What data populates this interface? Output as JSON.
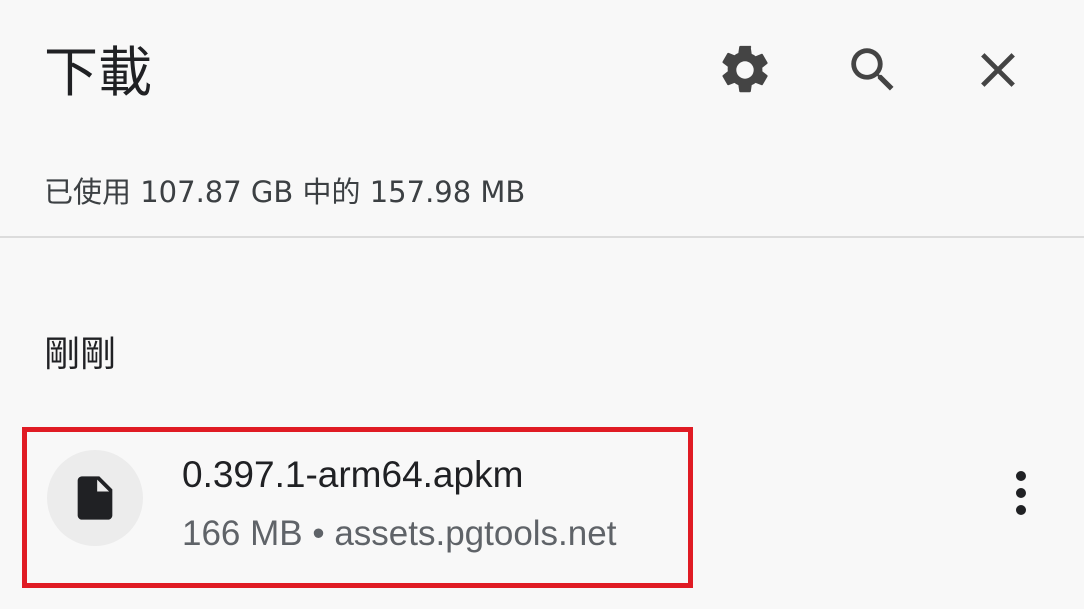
{
  "header": {
    "title": "下載"
  },
  "storage": {
    "text": "已使用 107.87 GB 中的 157.98 MB"
  },
  "section": {
    "header": "剛剛"
  },
  "downloads": [
    {
      "file_name": "0.397.1-arm64.apkm",
      "meta": "166 MB • assets.pgtools.net"
    }
  ],
  "icons": {
    "settings": "gear-icon",
    "search": "search-icon",
    "close": "close-icon",
    "file": "file-icon",
    "more": "more-vert-icon"
  },
  "colors": {
    "background": "#f8f8f8",
    "highlight_border": "#e01b24",
    "icon": "#444444"
  }
}
